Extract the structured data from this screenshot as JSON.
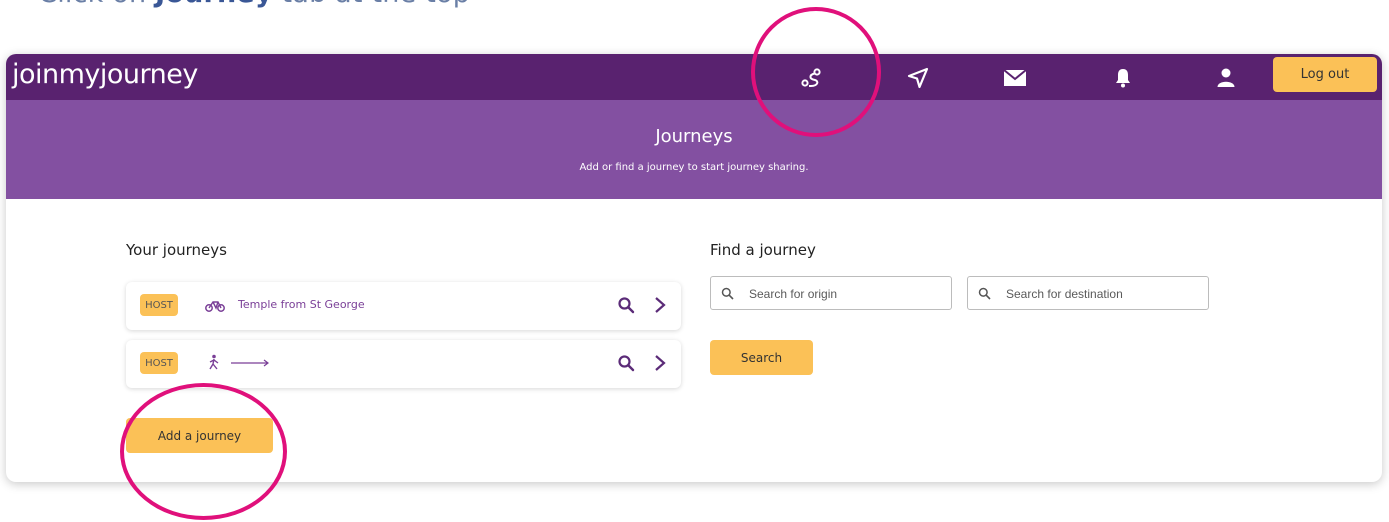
{
  "caption": {
    "prefix": "Click on ",
    "bold": "Journey",
    "suffix": " tab at the top"
  },
  "navbar": {
    "logo": "joinmyjourney",
    "icons": [
      "journey-icon",
      "send-icon",
      "mail-icon",
      "bell-icon",
      "user-icon"
    ],
    "logout_label": "Log out"
  },
  "hero": {
    "title": "Journeys",
    "subtitle": "Add or find a journey to start journey sharing."
  },
  "your_journeys": {
    "title": "Your journeys",
    "items": [
      {
        "badge": "HOST",
        "mode": "bike-icon",
        "label": "Temple from St George"
      },
      {
        "badge": "HOST",
        "mode": "walk-icon",
        "label": ""
      }
    ],
    "add_label": "Add a journey"
  },
  "find_journey": {
    "title": "Find a journey",
    "origin_placeholder": "Search for origin",
    "destination_placeholder": "Search for destination",
    "search_label": "Search"
  },
  "colors": {
    "navbar": "#59226f",
    "hero": "#8350a1",
    "accent": "#fbc157",
    "link": "#7a3f97",
    "highlight": "#e0107b"
  }
}
